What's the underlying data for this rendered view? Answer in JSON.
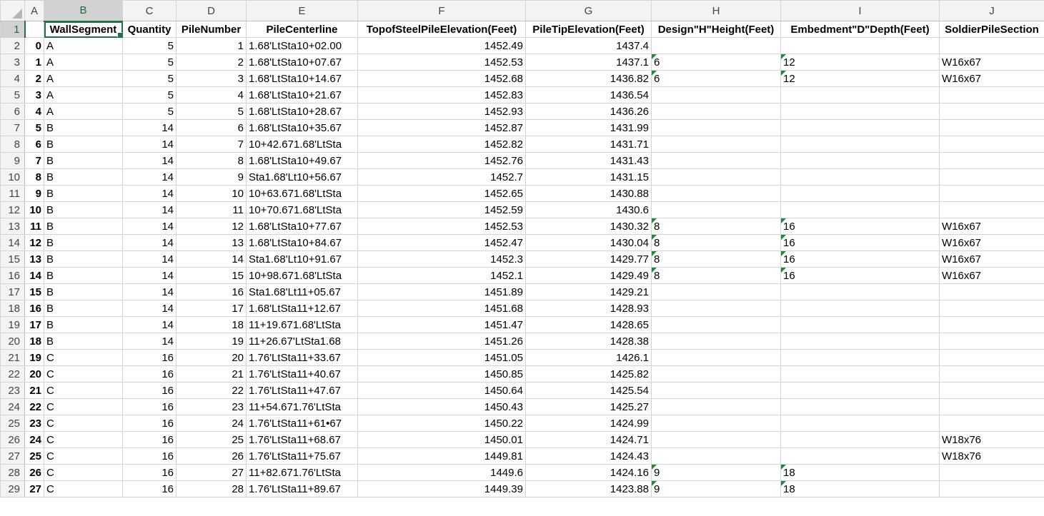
{
  "columns": [
    "A",
    "B",
    "C",
    "D",
    "E",
    "F",
    "G",
    "H",
    "I",
    "J"
  ],
  "selected_column": "B",
  "selected_row": "1",
  "colors": {
    "accent": "#217346",
    "error_marker": "#1f8a3b"
  },
  "headers": [
    "",
    "WallSegment",
    "Quantity",
    "PileNumber",
    "PileCenterline",
    "TopofSteelPileElevation(Feet)",
    "PileTipElevation(Feet)",
    "Design\"H\"Height(Feet)",
    "Embedment\"D\"Depth(Feet)",
    "SoldierPileSection"
  ],
  "rows": [
    {
      "n": "2",
      "cells": [
        "0",
        "A",
        "5",
        "1",
        "1.68'LtSta10+02.00",
        "1452.49",
        "1437.4",
        "",
        "",
        ""
      ]
    },
    {
      "n": "3",
      "cells": [
        "1",
        "A",
        "5",
        "2",
        "1.68'LtSta10+07.67",
        "1452.53",
        "1437.1",
        "6",
        "12",
        "W16x67"
      ]
    },
    {
      "n": "4",
      "cells": [
        "2",
        "A",
        "5",
        "3",
        "1.68'LtSta10+14.67",
        "1452.68",
        "1436.82",
        "6",
        "12",
        "W16x67"
      ]
    },
    {
      "n": "5",
      "cells": [
        "3",
        "A",
        "5",
        "4",
        "1.68'LtSta10+21.67",
        "1452.83",
        "1436.54",
        "",
        "",
        ""
      ]
    },
    {
      "n": "6",
      "cells": [
        "4",
        "A",
        "5",
        "5",
        "1.68'LtSta10+28.67",
        "1452.93",
        "1436.26",
        "",
        "",
        ""
      ]
    },
    {
      "n": "7",
      "cells": [
        "5",
        "B",
        "14",
        "6",
        "1.68'LtSta10+35.67",
        "1452.87",
        "1431.99",
        "",
        "",
        ""
      ]
    },
    {
      "n": "8",
      "cells": [
        "6",
        "B",
        "14",
        "7",
        "10+42.671.68'LtSta",
        "1452.82",
        "1431.71",
        "",
        "",
        ""
      ]
    },
    {
      "n": "9",
      "cells": [
        "7",
        "B",
        "14",
        "8",
        "1.68'LtSta10+49.67",
        "1452.76",
        "1431.43",
        "",
        "",
        ""
      ]
    },
    {
      "n": "10",
      "cells": [
        "8",
        "B",
        "14",
        "9",
        "Sta1.68'Lt10+56.67",
        "1452.7",
        "1431.15",
        "",
        "",
        ""
      ]
    },
    {
      "n": "11",
      "cells": [
        "9",
        "B",
        "14",
        "10",
        "10+63.671.68'LtSta",
        "1452.65",
        "1430.88",
        "",
        "",
        ""
      ]
    },
    {
      "n": "12",
      "cells": [
        "10",
        "B",
        "14",
        "11",
        "10+70.671.68'LtSta",
        "1452.59",
        "1430.6",
        "",
        "",
        ""
      ]
    },
    {
      "n": "13",
      "cells": [
        "11",
        "B",
        "14",
        "12",
        "1.68'LtSta10+77.67",
        "1452.53",
        "1430.32",
        "8",
        "16",
        "W16x67"
      ]
    },
    {
      "n": "14",
      "cells": [
        "12",
        "B",
        "14",
        "13",
        "1.68'LtSta10+84.67",
        "1452.47",
        "1430.04",
        "8",
        "16",
        "W16x67"
      ]
    },
    {
      "n": "15",
      "cells": [
        "13",
        "B",
        "14",
        "14",
        "Sta1.68'Lt10+91.67",
        "1452.3",
        "1429.77",
        "8",
        "16",
        "W16x67"
      ]
    },
    {
      "n": "16",
      "cells": [
        "14",
        "B",
        "14",
        "15",
        "10+98.671.68'LtSta",
        "1452.1",
        "1429.49",
        "8",
        "16",
        "W16x67"
      ]
    },
    {
      "n": "17",
      "cells": [
        "15",
        "B",
        "14",
        "16",
        "Sta1.68'Lt11+05.67",
        "1451.89",
        "1429.21",
        "",
        "",
        ""
      ]
    },
    {
      "n": "18",
      "cells": [
        "16",
        "B",
        "14",
        "17",
        "1.68'LtSta11+12.67",
        "1451.68",
        "1428.93",
        "",
        "",
        ""
      ]
    },
    {
      "n": "19",
      "cells": [
        "17",
        "B",
        "14",
        "18",
        "11+19.671.68'LtSta",
        "1451.47",
        "1428.65",
        "",
        "",
        ""
      ]
    },
    {
      "n": "20",
      "cells": [
        "18",
        "B",
        "14",
        "19",
        "11+26.67'LtSta1.68",
        "1451.26",
        "1428.38",
        "",
        "",
        ""
      ]
    },
    {
      "n": "21",
      "cells": [
        "19",
        "C",
        "16",
        "20",
        "1.76'LtSta11+33.67",
        "1451.05",
        "1426.1",
        "",
        "",
        ""
      ]
    },
    {
      "n": "22",
      "cells": [
        "20",
        "C",
        "16",
        "21",
        "1.76'LtSta11+40.67",
        "1450.85",
        "1425.82",
        "",
        "",
        ""
      ]
    },
    {
      "n": "23",
      "cells": [
        "21",
        "C",
        "16",
        "22",
        "1.76'LtSta11+47.67",
        "1450.64",
        "1425.54",
        "",
        "",
        ""
      ]
    },
    {
      "n": "24",
      "cells": [
        "22",
        "C",
        "16",
        "23",
        "11+54.671.76'LtSta",
        "1450.43",
        "1425.27",
        "",
        "",
        ""
      ]
    },
    {
      "n": "25",
      "cells": [
        "23",
        "C",
        "16",
        "24",
        "1.76'LtSta11+61•67",
        "1450.22",
        "1424.99",
        "",
        "",
        ""
      ]
    },
    {
      "n": "26",
      "cells": [
        "24",
        "C",
        "16",
        "25",
        "1.76'LtSta11+68.67",
        "1450.01",
        "1424.71",
        "",
        "",
        "W18x76"
      ]
    },
    {
      "n": "27",
      "cells": [
        "25",
        "C",
        "16",
        "26",
        "1.76'LtSta11+75.67",
        "1449.81",
        "1424.43",
        "",
        "",
        "W18x76"
      ]
    },
    {
      "n": "28",
      "cells": [
        "26",
        "C",
        "16",
        "27",
        "11+82.671.76'LtSta",
        "1449.6",
        "1424.16",
        "9",
        "18",
        ""
      ]
    },
    {
      "n": "29",
      "cells": [
        "27",
        "C",
        "16",
        "28",
        "1.76'LtSta11+89.67",
        "1449.39",
        "1423.88",
        "9",
        "18",
        ""
      ]
    }
  ]
}
